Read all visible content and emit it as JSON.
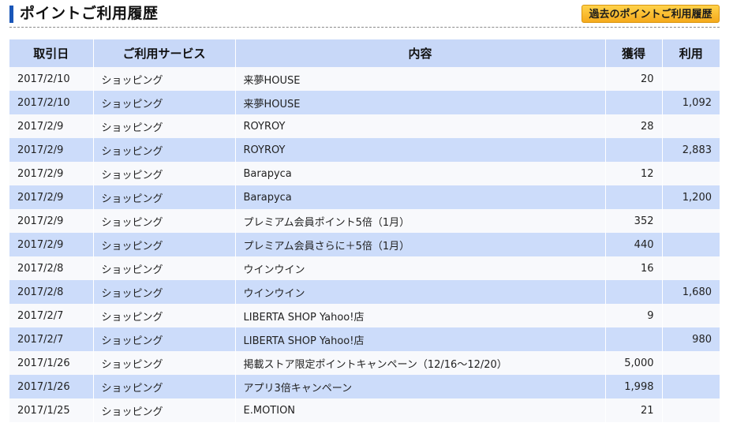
{
  "header": {
    "title": "ポイントご利用履歴",
    "past_button": "過去のポイントご利用履歴"
  },
  "table": {
    "columns": [
      "取引日",
      "ご利用サービス",
      "内容",
      "獲得",
      "利用"
    ],
    "rows": [
      {
        "date": "2017/2/10",
        "service": "ショッピング",
        "content": "来夢HOUSE",
        "link": true,
        "earned": "20",
        "used": ""
      },
      {
        "date": "2017/2/10",
        "service": "ショッピング",
        "content": "来夢HOUSE",
        "link": false,
        "earned": "",
        "used": "1,092"
      },
      {
        "date": "2017/2/9",
        "service": "ショッピング",
        "content": "ROYROY",
        "link": true,
        "earned": "28",
        "used": ""
      },
      {
        "date": "2017/2/9",
        "service": "ショッピング",
        "content": "ROYROY",
        "link": false,
        "earned": "",
        "used": "2,883"
      },
      {
        "date": "2017/2/9",
        "service": "ショッピング",
        "content": "Barapyca",
        "link": true,
        "earned": "12",
        "used": ""
      },
      {
        "date": "2017/2/9",
        "service": "ショッピング",
        "content": "Barapyca",
        "link": false,
        "earned": "",
        "used": "1,200"
      },
      {
        "date": "2017/2/9",
        "service": "ショッピング",
        "content": "プレミアム会員ポイント5倍（1月）",
        "link": false,
        "earned": "352",
        "used": ""
      },
      {
        "date": "2017/2/9",
        "service": "ショッピング",
        "content": "プレミアム会員さらに＋5倍（1月）",
        "link": false,
        "earned": "440",
        "used": ""
      },
      {
        "date": "2017/2/8",
        "service": "ショッピング",
        "content": "ウインウイン",
        "link": true,
        "earned": "16",
        "used": ""
      },
      {
        "date": "2017/2/8",
        "service": "ショッピング",
        "content": "ウインウイン",
        "link": false,
        "earned": "",
        "used": "1,680"
      },
      {
        "date": "2017/2/7",
        "service": "ショッピング",
        "content": "LIBERTA SHOP Yahoo!店",
        "link": true,
        "earned": "9",
        "used": ""
      },
      {
        "date": "2017/2/7",
        "service": "ショッピング",
        "content": "LIBERTA SHOP Yahoo!店",
        "link": false,
        "earned": "",
        "used": "980"
      },
      {
        "date": "2017/1/26",
        "service": "ショッピング",
        "content": "掲載ストア限定ポイントキャンペーン（12/16～12/20）",
        "link": false,
        "earned": "5,000",
        "used": ""
      },
      {
        "date": "2017/1/26",
        "service": "ショッピング",
        "content": "アプリ3倍キャンペーン",
        "link": false,
        "earned": "1,998",
        "used": ""
      },
      {
        "date": "2017/1/25",
        "service": "ショッピング",
        "content": "E.MOTION",
        "link": true,
        "earned": "21",
        "used": ""
      }
    ]
  },
  "colors": {
    "accent": "#1a56b8",
    "header_row": "#c8d8f8",
    "stripe": "#ccdcfa",
    "link": "#1ea1b8",
    "button": "#f5aa1c"
  }
}
